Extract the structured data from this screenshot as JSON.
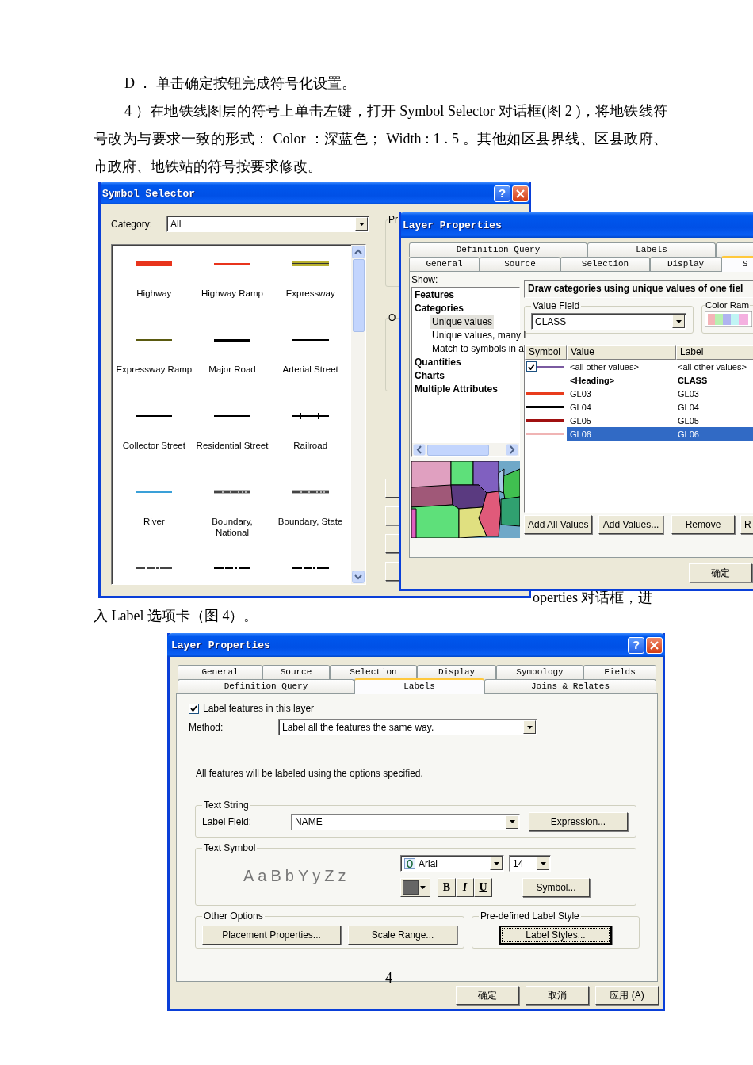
{
  "paragraphs": [
    "D ． 单击确定按钮完成符号化设置。",
    "4 ）在地铁线图层的符号上单击左键，打开 Symbol Selector 对话框(图 2 )，将地铁线符号改为与要求一致的形式： Color ：深蓝色； Width : 1 . 5 。其他如区县界线、区县政府、市政府、地铁站的符号按要求修改。"
  ],
  "figure_1": {
    "symbol_selector": {
      "title": "Symbol Selector",
      "help": "?",
      "category_label": "Category:",
      "category_value": "All",
      "symbols": [
        {
          "name": "Highway",
          "kind": "thick",
          "color": "#e8341c"
        },
        {
          "name": "Highway Ramp",
          "kind": "medium",
          "color": "#e8341c"
        },
        {
          "name": "Expressway",
          "kind": "double",
          "color": "#b8b030"
        },
        {
          "name": "Expressway Ramp",
          "kind": "medium",
          "color": "#5a5a10"
        },
        {
          "name": "Major Road",
          "kind": "bold",
          "color": "#000000"
        },
        {
          "name": "Arterial Street",
          "kind": "thin",
          "color": "#000000"
        },
        {
          "name": "Collector Street",
          "kind": "thin",
          "color": "#000000"
        },
        {
          "name": "Residential Street",
          "kind": "thin",
          "color": "#000000"
        },
        {
          "name": "Railroad",
          "kind": "rail",
          "color": "#000000"
        },
        {
          "name": "River",
          "kind": "thin",
          "color": "#3aa0d8"
        },
        {
          "name": "Boundary, National",
          "kind": "boundary",
          "color": "#444444"
        },
        {
          "name": "Boundary, State",
          "kind": "boundary",
          "color": "#444444"
        },
        {
          "kind": "dashdot",
          "color": "#444444"
        },
        {
          "kind": "dashdot",
          "color": "#000000"
        },
        {
          "kind": "dashdot",
          "color": "#000000"
        }
      ],
      "side_groups": [
        "Pr",
        "O"
      ]
    },
    "layer_properties": {
      "title": "Layer Properties",
      "tabs_back": [
        {
          "label": "Definition Query",
          "selected": false
        },
        {
          "label": "Labels",
          "selected": false
        },
        {
          "selected": false
        }
      ],
      "tabs_front": [
        {
          "label": "General",
          "selected": false
        },
        {
          "label": "Source",
          "selected": false
        },
        {
          "label": "Selection",
          "selected": false
        },
        {
          "label": "Display",
          "selected": false
        },
        {
          "label": "S",
          "selected": true
        }
      ],
      "show_label": "Show:",
      "show_tree": [
        {
          "label": "Features",
          "selected": false
        },
        {
          "label": "Categories",
          "selected": false,
          "children": [
            {
              "label": "Unique values",
              "selected": true
            },
            {
              "label": "Unique values, many l",
              "selected": false
            },
            {
              "label": "Match to symbols in a",
              "selected": false
            }
          ]
        },
        {
          "label": "Quantities",
          "selected": false
        },
        {
          "label": "Charts",
          "selected": false
        },
        {
          "label": "Multiple Attributes",
          "selected": false
        }
      ],
      "heading": "Draw categories using unique values of one fiel",
      "value_field_label": "Value Field",
      "value_field": "CLASS",
      "color_ramp_label": "Color Ram",
      "columns": [
        "Symbol",
        "Value",
        "Label"
      ],
      "rows": [
        {
          "kind": "default",
          "checked": true,
          "color": "#7a5aa0",
          "value": "<all other values>",
          "label": "<all other values>",
          "selected": false
        },
        {
          "kind": "heading",
          "value": "<Heading>",
          "label": "CLASS",
          "selected": false
        },
        {
          "kind": "value",
          "color": "#e83c1c",
          "value": "GL03",
          "label": "GL03",
          "selected": false
        },
        {
          "kind": "value",
          "color": "#000000",
          "value": "GL04",
          "label": "GL04",
          "selected": false
        },
        {
          "kind": "value",
          "color": "#a01010",
          "value": "GL05",
          "label": "GL05",
          "selected": false
        },
        {
          "kind": "value",
          "color": "#f0b4b4",
          "value": "GL06",
          "label": "GL06",
          "selected": true
        }
      ],
      "buttons": [
        "Add All Values",
        "Add Values...",
        "Remove",
        "R"
      ],
      "ok": "确定"
    },
    "text_behind": "operties 对话框，进"
  },
  "paragraph_after": "入 Label 选项卡（图 4）。",
  "figure_2": {
    "title": "Layer Properties",
    "help": "?",
    "tabs_back": [
      {
        "label": "General",
        "selected": false
      },
      {
        "label": "Source",
        "selected": false
      },
      {
        "label": "Selection",
        "selected": false
      },
      {
        "label": "Display",
        "selected": false
      },
      {
        "label": "Symbology",
        "selected": false
      },
      {
        "label": "Fields",
        "selected": false
      }
    ],
    "tabs_front": [
      {
        "label": "Definition Query",
        "selected": false
      },
      {
        "label": "Labels",
        "selected": true
      },
      {
        "label": "Joins & Relates",
        "selected": false
      }
    ],
    "label_features": {
      "label": "Label features in this layer",
      "checked": true
    },
    "method_label": "Method:",
    "method_value": "Label all the features the same way.",
    "info": "All features will be labeled using the options specified.",
    "text_string": {
      "legend": "Text String",
      "field_label": "Label Field:",
      "field_value": "NAME",
      "button": "Expression..."
    },
    "text_symbol": {
      "legend": "Text Symbol",
      "preview": "AaBbYyZz",
      "font": "Arial",
      "size": "14",
      "bold": "B",
      "italic": "I",
      "underline": "U",
      "button": "Symbol..."
    },
    "other_options": {
      "legend": "Other Options",
      "buttons": [
        "Placement Properties...",
        "Scale Range..."
      ]
    },
    "predefined": {
      "legend": "Pre-defined Label Style",
      "button": "Label Styles..."
    },
    "footer": [
      "确定",
      "取消",
      "应用 (A)"
    ]
  },
  "page_number": "4"
}
